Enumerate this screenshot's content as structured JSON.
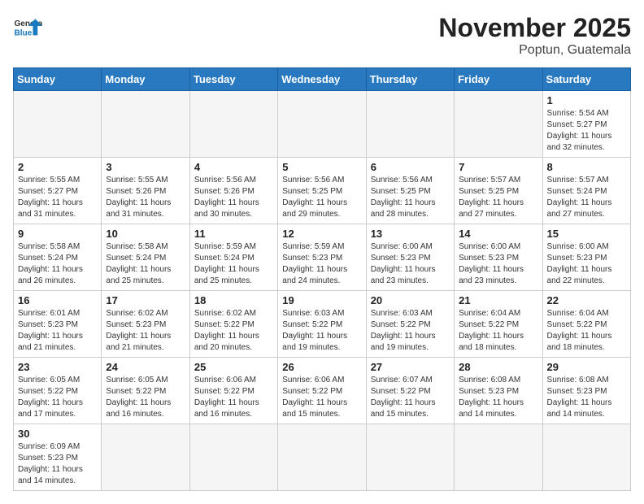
{
  "header": {
    "logo_general": "General",
    "logo_blue": "Blue",
    "title": "November 2025",
    "subtitle": "Poptun, Guatemala"
  },
  "calendar": {
    "days_of_week": [
      "Sunday",
      "Monday",
      "Tuesday",
      "Wednesday",
      "Thursday",
      "Friday",
      "Saturday"
    ],
    "weeks": [
      [
        {
          "num": "",
          "info": ""
        },
        {
          "num": "",
          "info": ""
        },
        {
          "num": "",
          "info": ""
        },
        {
          "num": "",
          "info": ""
        },
        {
          "num": "",
          "info": ""
        },
        {
          "num": "",
          "info": ""
        },
        {
          "num": "1",
          "info": "Sunrise: 5:54 AM\nSunset: 5:27 PM\nDaylight: 11 hours\nand 32 minutes."
        }
      ],
      [
        {
          "num": "2",
          "info": "Sunrise: 5:55 AM\nSunset: 5:27 PM\nDaylight: 11 hours\nand 31 minutes."
        },
        {
          "num": "3",
          "info": "Sunrise: 5:55 AM\nSunset: 5:26 PM\nDaylight: 11 hours\nand 31 minutes."
        },
        {
          "num": "4",
          "info": "Sunrise: 5:56 AM\nSunset: 5:26 PM\nDaylight: 11 hours\nand 30 minutes."
        },
        {
          "num": "5",
          "info": "Sunrise: 5:56 AM\nSunset: 5:25 PM\nDaylight: 11 hours\nand 29 minutes."
        },
        {
          "num": "6",
          "info": "Sunrise: 5:56 AM\nSunset: 5:25 PM\nDaylight: 11 hours\nand 28 minutes."
        },
        {
          "num": "7",
          "info": "Sunrise: 5:57 AM\nSunset: 5:25 PM\nDaylight: 11 hours\nand 27 minutes."
        },
        {
          "num": "8",
          "info": "Sunrise: 5:57 AM\nSunset: 5:24 PM\nDaylight: 11 hours\nand 27 minutes."
        }
      ],
      [
        {
          "num": "9",
          "info": "Sunrise: 5:58 AM\nSunset: 5:24 PM\nDaylight: 11 hours\nand 26 minutes."
        },
        {
          "num": "10",
          "info": "Sunrise: 5:58 AM\nSunset: 5:24 PM\nDaylight: 11 hours\nand 25 minutes."
        },
        {
          "num": "11",
          "info": "Sunrise: 5:59 AM\nSunset: 5:24 PM\nDaylight: 11 hours\nand 25 minutes."
        },
        {
          "num": "12",
          "info": "Sunrise: 5:59 AM\nSunset: 5:23 PM\nDaylight: 11 hours\nand 24 minutes."
        },
        {
          "num": "13",
          "info": "Sunrise: 6:00 AM\nSunset: 5:23 PM\nDaylight: 11 hours\nand 23 minutes."
        },
        {
          "num": "14",
          "info": "Sunrise: 6:00 AM\nSunset: 5:23 PM\nDaylight: 11 hours\nand 23 minutes."
        },
        {
          "num": "15",
          "info": "Sunrise: 6:00 AM\nSunset: 5:23 PM\nDaylight: 11 hours\nand 22 minutes."
        }
      ],
      [
        {
          "num": "16",
          "info": "Sunrise: 6:01 AM\nSunset: 5:23 PM\nDaylight: 11 hours\nand 21 minutes."
        },
        {
          "num": "17",
          "info": "Sunrise: 6:02 AM\nSunset: 5:23 PM\nDaylight: 11 hours\nand 21 minutes."
        },
        {
          "num": "18",
          "info": "Sunrise: 6:02 AM\nSunset: 5:22 PM\nDaylight: 11 hours\nand 20 minutes."
        },
        {
          "num": "19",
          "info": "Sunrise: 6:03 AM\nSunset: 5:22 PM\nDaylight: 11 hours\nand 19 minutes."
        },
        {
          "num": "20",
          "info": "Sunrise: 6:03 AM\nSunset: 5:22 PM\nDaylight: 11 hours\nand 19 minutes."
        },
        {
          "num": "21",
          "info": "Sunrise: 6:04 AM\nSunset: 5:22 PM\nDaylight: 11 hours\nand 18 minutes."
        },
        {
          "num": "22",
          "info": "Sunrise: 6:04 AM\nSunset: 5:22 PM\nDaylight: 11 hours\nand 18 minutes."
        }
      ],
      [
        {
          "num": "23",
          "info": "Sunrise: 6:05 AM\nSunset: 5:22 PM\nDaylight: 11 hours\nand 17 minutes."
        },
        {
          "num": "24",
          "info": "Sunrise: 6:05 AM\nSunset: 5:22 PM\nDaylight: 11 hours\nand 16 minutes."
        },
        {
          "num": "25",
          "info": "Sunrise: 6:06 AM\nSunset: 5:22 PM\nDaylight: 11 hours\nand 16 minutes."
        },
        {
          "num": "26",
          "info": "Sunrise: 6:06 AM\nSunset: 5:22 PM\nDaylight: 11 hours\nand 15 minutes."
        },
        {
          "num": "27",
          "info": "Sunrise: 6:07 AM\nSunset: 5:22 PM\nDaylight: 11 hours\nand 15 minutes."
        },
        {
          "num": "28",
          "info": "Sunrise: 6:08 AM\nSunset: 5:23 PM\nDaylight: 11 hours\nand 14 minutes."
        },
        {
          "num": "29",
          "info": "Sunrise: 6:08 AM\nSunset: 5:23 PM\nDaylight: 11 hours\nand 14 minutes."
        }
      ],
      [
        {
          "num": "30",
          "info": "Sunrise: 6:09 AM\nSunset: 5:23 PM\nDaylight: 11 hours\nand 14 minutes."
        },
        {
          "num": "",
          "info": ""
        },
        {
          "num": "",
          "info": ""
        },
        {
          "num": "",
          "info": ""
        },
        {
          "num": "",
          "info": ""
        },
        {
          "num": "",
          "info": ""
        },
        {
          "num": "",
          "info": ""
        }
      ]
    ]
  }
}
